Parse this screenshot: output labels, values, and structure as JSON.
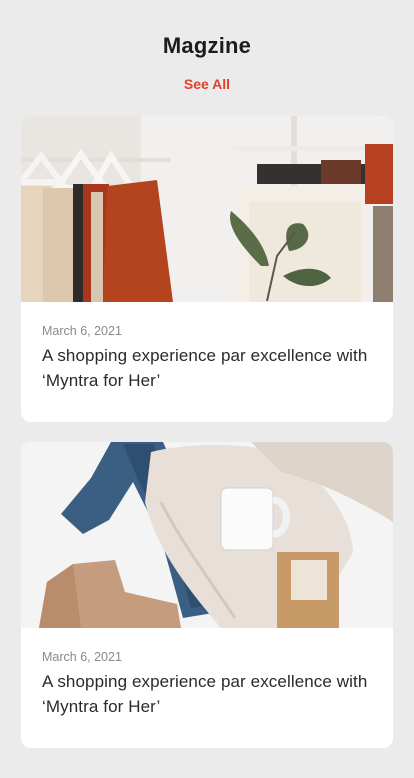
{
  "header": {
    "title": "Magzine",
    "see_all_label": "See All"
  },
  "colors": {
    "background": "#ebebeb",
    "accent": "#e0402c",
    "card": "#ffffff"
  },
  "articles": [
    {
      "image": "clothes-rack-photo",
      "date": "March 6, 2021",
      "title": "A shopping experience par excellence with ‘Myntra for Her’"
    },
    {
      "image": "flatlay-outfit-photo",
      "date": "March 6, 2021",
      "title": "A shopping experience par excellence with ‘Myntra for Her’"
    }
  ]
}
